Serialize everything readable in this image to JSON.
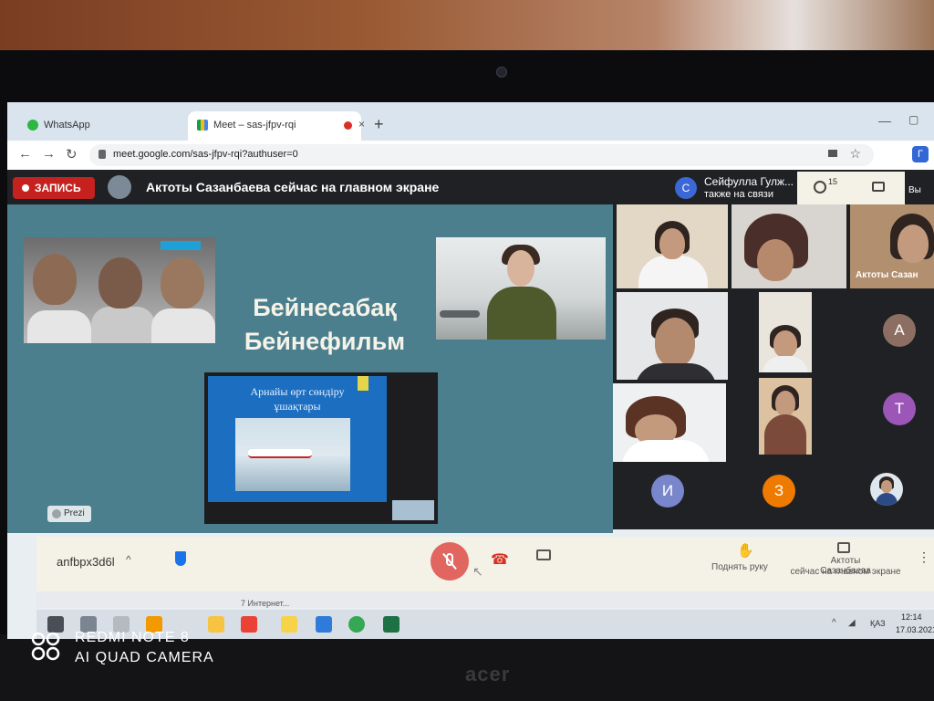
{
  "browser": {
    "tabs": [
      {
        "label": "WhatsApp"
      },
      {
        "label": "Meet – sas-jfpv-rqi"
      }
    ],
    "url": "meet.google.com/sas-jfpv-rqi?authuser=0",
    "profile_letter": "Г",
    "new_tab_glyph": "+",
    "close_glyph": "×"
  },
  "meet": {
    "recording_label": "ЗАПИСЬ",
    "presenting_text": "Актоты Сазанбаева сейчас на главном экране",
    "joined_avatar_letter": "С",
    "joined_name": "Сейфулла Гулж...",
    "joined_status": "также на связи",
    "people_count": "15",
    "you_label": "Вы",
    "tile_name_label": "Актоты Сазан",
    "avatar_letters": [
      "А",
      "Т",
      "И",
      "З"
    ],
    "meeting_code": "anfbpx3d6l",
    "raise_hand_label": "Поднять руку",
    "presenting_line_1": "Актоты Сазанбаева",
    "presenting_line_2": "сейчас на главном экране",
    "more_glyph": "⋮",
    "chevron_glyph": "^"
  },
  "slide": {
    "title_line_1": "Бейнесабақ",
    "title_line_2": "Бейнефильм",
    "video_caption_line_1": "Арнайы өрт сөндіру",
    "video_caption_line_2": "ұшақтары",
    "prezi_label": "Prezi"
  },
  "behind_window_text": "7 Интернет...",
  "taskbar": {
    "language": "ҚАЗ",
    "time": "12:14",
    "date": "17.03.2021"
  },
  "watermark": {
    "line_1": "REDMI NOTE 8",
    "line_2": "AI QUAD CAMERA"
  },
  "bezel_brand": "acer",
  "icons": [
    "whatsapp-icon",
    "meet-icon",
    "recording-dot-icon",
    "back-icon",
    "forward-icon",
    "reload-icon",
    "lock-icon",
    "camera-indicator-icon",
    "star-icon",
    "people-icon",
    "chat-icon",
    "shield-icon",
    "mic-off-icon",
    "hangup-icon",
    "camera-icon",
    "raise-hand-icon",
    "present-icon"
  ],
  "colors": {
    "recording_red": "#c5221f",
    "mic_off_red": "#e0665f",
    "meet_dark": "#202124",
    "slide_teal": "#4b7f8e",
    "controls_bg": "#f4f1e6"
  }
}
